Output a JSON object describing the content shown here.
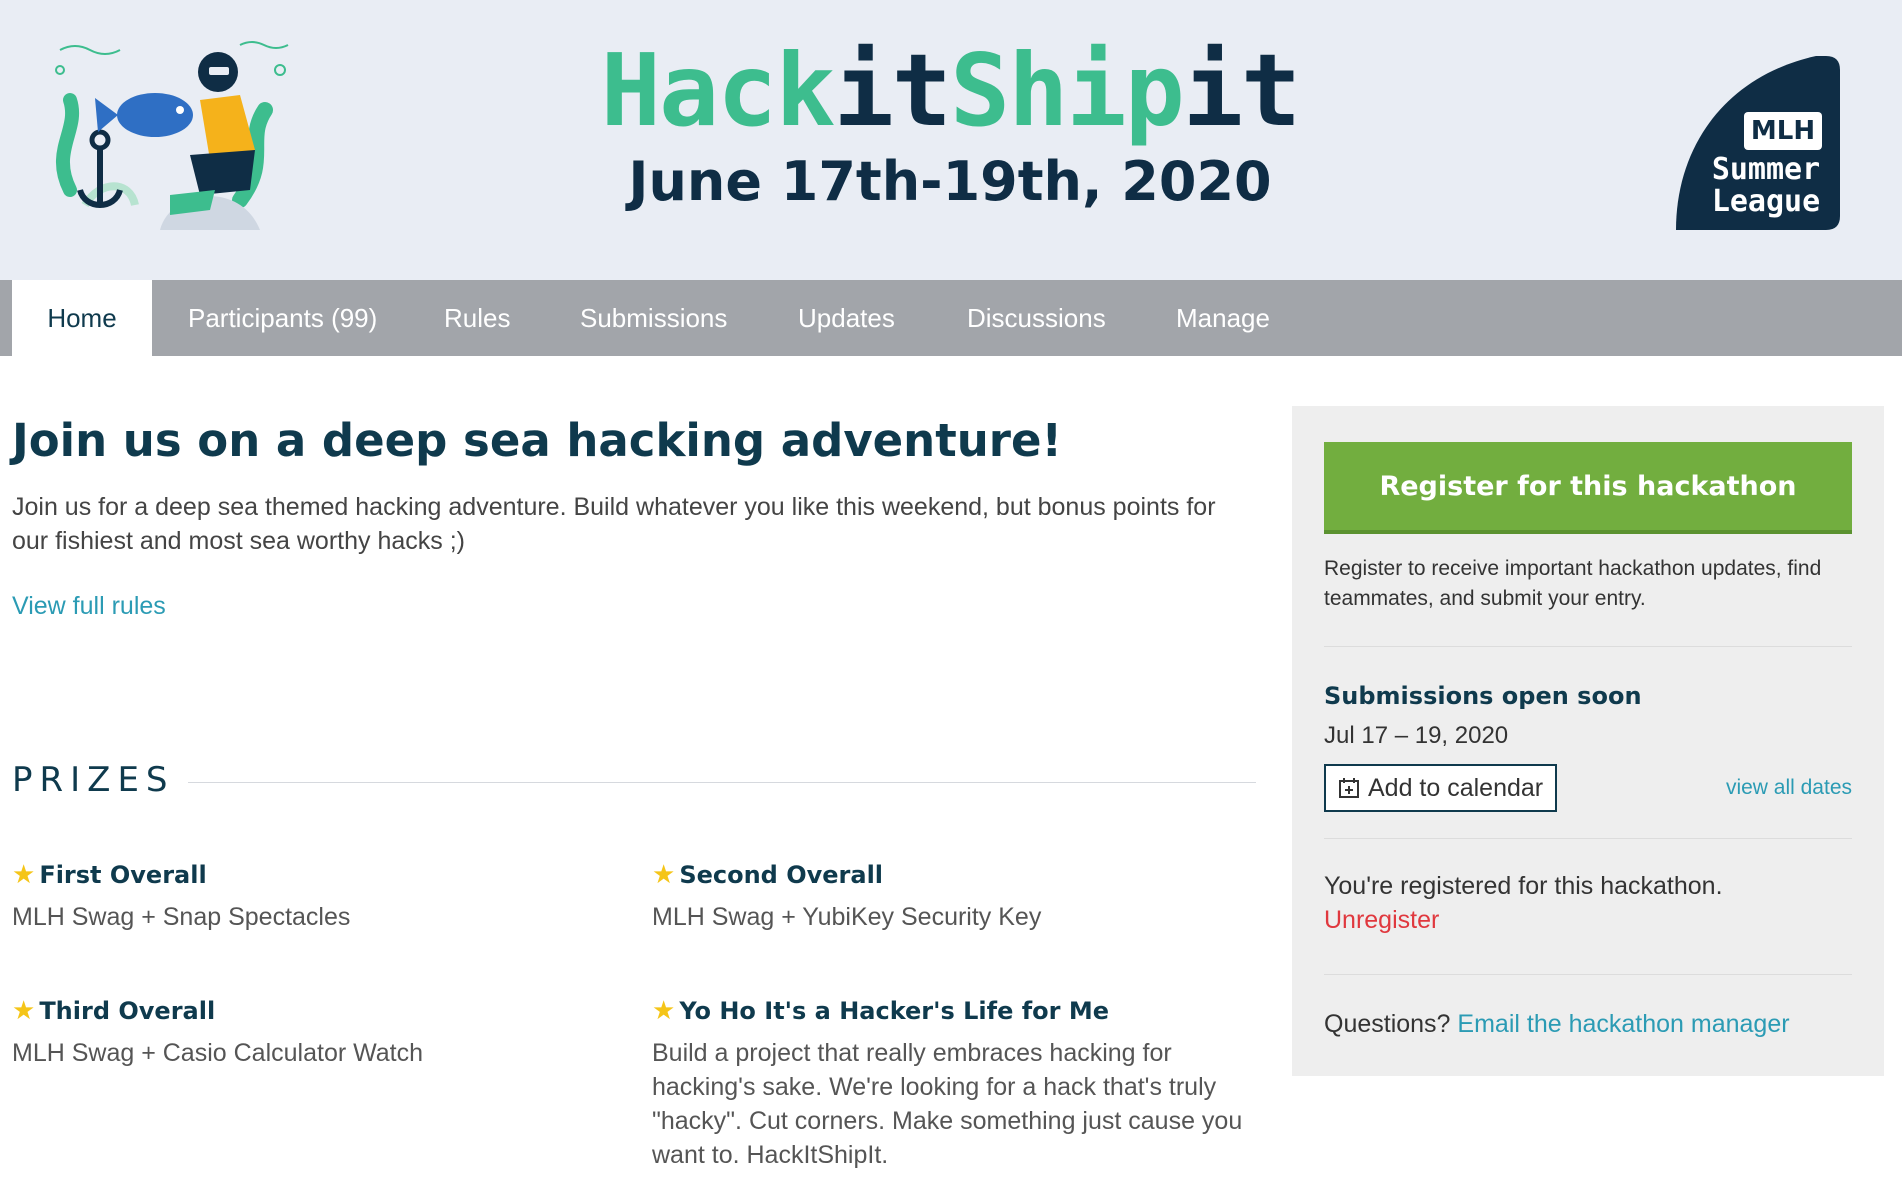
{
  "banner": {
    "event_name_part1": "Hack",
    "event_name_part2": "it",
    "event_name_part3": "Ship",
    "event_name_part4": "it",
    "event_dates": "June 17th-19th, 2020",
    "badge_line1": "MLH",
    "badge_line2": "Summer",
    "badge_line3": "League"
  },
  "tabs": [
    {
      "label": "Home",
      "active": true
    },
    {
      "label": "Participants (99)"
    },
    {
      "label": "Rules"
    },
    {
      "label": "Submissions"
    },
    {
      "label": "Updates"
    },
    {
      "label": "Discussions"
    },
    {
      "label": "Manage"
    }
  ],
  "main": {
    "headline": "Join us on a deep sea hacking adventure!",
    "intro": "Join us for a deep sea themed hacking adventure. Build whatever you like this weekend, but bonus points for our fishiest and most sea worthy hacks ;)",
    "rules_link": "View full rules",
    "prizes_heading": "PRIZES",
    "prizes": [
      {
        "title": "First Overall",
        "desc": "MLH Swag + Snap Spectacles"
      },
      {
        "title": "Second Overall",
        "desc": "MLH Swag + YubiKey Security Key"
      },
      {
        "title": "Third Overall",
        "desc": "MLH Swag + Casio Calculator Watch"
      },
      {
        "title": "Yo Ho It's a Hacker's Life for Me",
        "desc": "Build a project that really embraces hacking for hacking's sake. We're looking for a hack that's truly \"hacky\". Cut corners. Make something just cause you want to. HackItShipIt."
      }
    ]
  },
  "sidebar": {
    "register_button": "Register for this hackathon",
    "register_note": "Register to receive important hackathon updates, find teammates, and submit your entry.",
    "submissions_title": "Submissions open soon",
    "submissions_dates": "Jul 17 – 19, 2020",
    "add_calendar": "Add to calendar",
    "view_all_dates": "view all dates",
    "registered_text": "You're registered for this hackathon.",
    "unregister": "Unregister",
    "questions_prefix": "Questions?",
    "questions_link": "Email the hackathon manager"
  },
  "colors": {
    "accent_green": "#3dbd8e",
    "navy": "#0f2d45",
    "register_green": "#72ae3f",
    "link_teal": "#2b9bb4",
    "danger_red": "#e0383e",
    "star_yellow": "#f5c518"
  }
}
